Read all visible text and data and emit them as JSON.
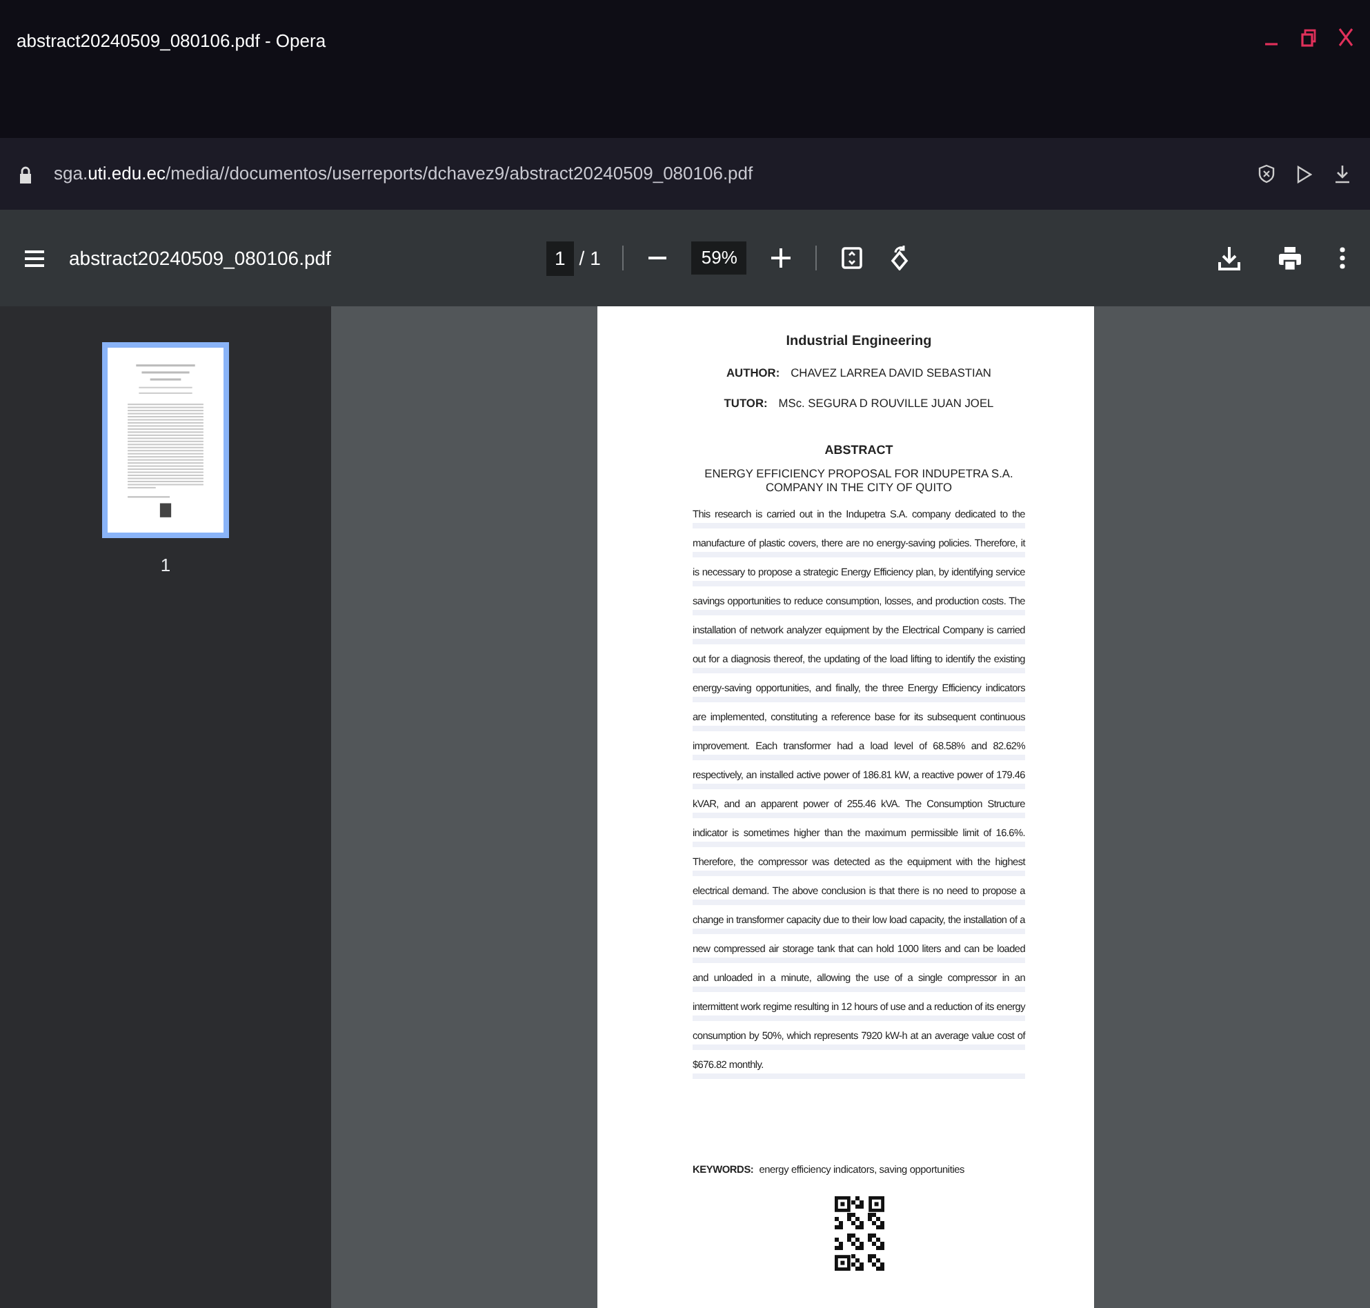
{
  "window": {
    "title": "abstract20240509_080106.pdf - Opera"
  },
  "address_bar": {
    "url": "sga.**uti.edu.ec**/media//documentos/userreports/dchavez9/abstract20240509_080106.pdf"
  },
  "pdf_toolbar": {
    "file_name": "abstract20240509_080106.pdf",
    "page_current": "1",
    "page_total": "/ 1",
    "zoom": "59%"
  },
  "thumbnails": [
    {
      "label": "1",
      "selected": true
    }
  ],
  "document": {
    "department": "Industrial Engineering",
    "people": [
      {
        "role": "AUTHOR:",
        "name": "CHAVEZ LARREA DAVID SEBASTIAN"
      },
      {
        "role": "TUTOR:",
        "name": "MSc. SEGURA D ROUVILLE JUAN JOEL"
      }
    ],
    "heading": "ABSTRACT",
    "title": "ENERGY EFFICIENCY PROPOSAL FOR INDUPETRA S.A. COMPANY IN THE CITY OF QUITO",
    "body": "This research is carried out in the Indupetra S.A. company dedicated to the manufacture of plastic covers, there are no energy-saving policies. Therefore, it is necessary to propose a strategic Energy Efficiency plan, by identifying service savings opportunities to reduce consumption, losses, and production costs. The installation of network analyzer equipment by the Electrical Company is carried out for a diagnosis thereof, the updating of the load lifting to identify the existing energy-saving opportunities, and finally, the three Energy Efficiency indicators are implemented, constituting a reference base for its subsequent continuous improvement. Each transformer had a load level of 68.58% and 82.62% respectively, an installed active power of 186.81 kW, a reactive power of 179.46 kVAR, and an apparent power of 255.46 kVA. The Consumption Structure indicator is sometimes higher than the maximum permissible limit of 16.6%. Therefore, the compressor was detected as the equipment with the highest electrical demand. The above conclusion is that there is no need to propose a change in transformer capacity due to their low load capacity, the installation of a new compressed air storage tank that can hold 1000 liters and can be loaded and unloaded in a minute, allowing the use of a single compressor in an intermittent work regime resulting in 12 hours of use and a reduction of its energy consumption by 50%, which represents 7920 kW-h at an average value cost of $676.82 monthly.",
    "keywords_label": "KEYWORDS:",
    "keywords": "energy efficiency indicators, saving opportunities"
  }
}
